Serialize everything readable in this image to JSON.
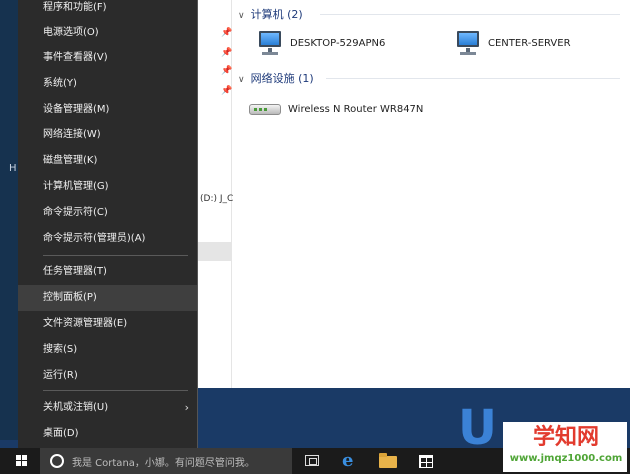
{
  "context_menu": {
    "items": [
      {
        "label": "程序和功能(F)"
      },
      {
        "label": "电源选项(O)"
      },
      {
        "label": "事件查看器(V)"
      },
      {
        "label": "系统(Y)"
      },
      {
        "label": "设备管理器(M)"
      },
      {
        "label": "网络连接(W)"
      },
      {
        "label": "磁盘管理(K)"
      },
      {
        "label": "计算机管理(G)"
      },
      {
        "label": "命令提示符(C)"
      },
      {
        "label": "命令提示符(管理员)(A)"
      },
      {
        "label": "任务管理器(T)"
      },
      {
        "label": "控制面板(P)",
        "highlighted": true
      },
      {
        "label": "文件资源管理器(E)"
      },
      {
        "label": "搜索(S)"
      },
      {
        "label": "运行(R)"
      },
      {
        "label": "关机或注销(U)",
        "has_submenu": true
      },
      {
        "label": "桌面(D)"
      }
    ]
  },
  "explorer": {
    "nav_partial_text": "(D:) J_C",
    "left_edge_letter": "H",
    "computers_section": {
      "header": "计算机 (2)",
      "items": [
        {
          "label": "DESKTOP-529APN6",
          "icon": "computer-icon"
        },
        {
          "label": "CENTER-SERVER",
          "icon": "computer-icon"
        }
      ]
    },
    "network_section": {
      "header": "网络设施 (1)",
      "items": [
        {
          "label": "Wireless N Router WR847N",
          "icon": "router-icon"
        }
      ]
    }
  },
  "taskbar": {
    "search_placeholder": "我是 Cortana，小娜。有问题尽管问我。"
  },
  "watermark": {
    "title": "学知网",
    "url": "www.jmqz1000.com"
  },
  "colors": {
    "menu_bg": "#2b2b2b",
    "menu_highlight": "#3f3f3f",
    "taskbar_bg": "#1b1b1b",
    "section_header": "#1e3a7a"
  }
}
